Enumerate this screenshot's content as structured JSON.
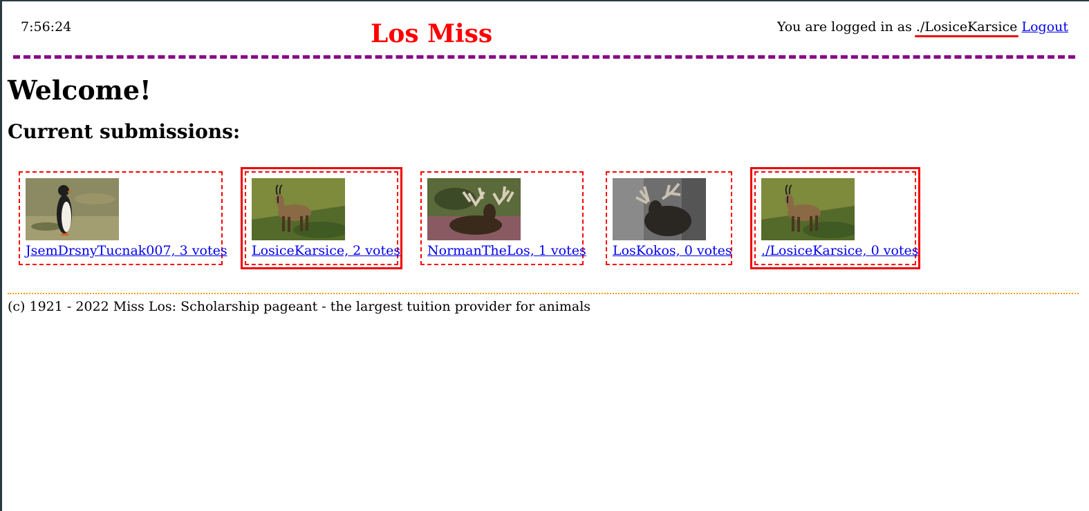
{
  "header": {
    "clock": "7:56:24",
    "title": "Los Miss",
    "login_prefix": "You are logged in as",
    "username": "./LosiceKarsice",
    "logout_label": "Logout"
  },
  "main": {
    "welcome": "Welcome!",
    "submissions_heading": "Current submissions:",
    "submissions": [
      {
        "label": "JsemDrsnyTucnak007, 3 votes",
        "image": "penguin",
        "highlighted": false
      },
      {
        "label": "LosiceKarsice, 2 votes",
        "image": "chamois",
        "highlighted": true
      },
      {
        "label": "NormanTheLos, 1 votes",
        "image": "moose-lying",
        "highlighted": false
      },
      {
        "label": "LosKokos, 0 votes",
        "image": "moose-bw",
        "highlighted": false
      },
      {
        "label": "./LosiceKarsice, 0 votes",
        "image": "chamois",
        "highlighted": true
      }
    ]
  },
  "footer": {
    "text": "(c) 1921 - 2022 Miss Los: Scholarship pageant - the largest tuition provider for animals"
  },
  "colors": {
    "title": "#ff0000",
    "header_rule": "#880088",
    "card_border": "#ff0000",
    "link": "#0000ee",
    "footer_rule": "#e8a000"
  }
}
